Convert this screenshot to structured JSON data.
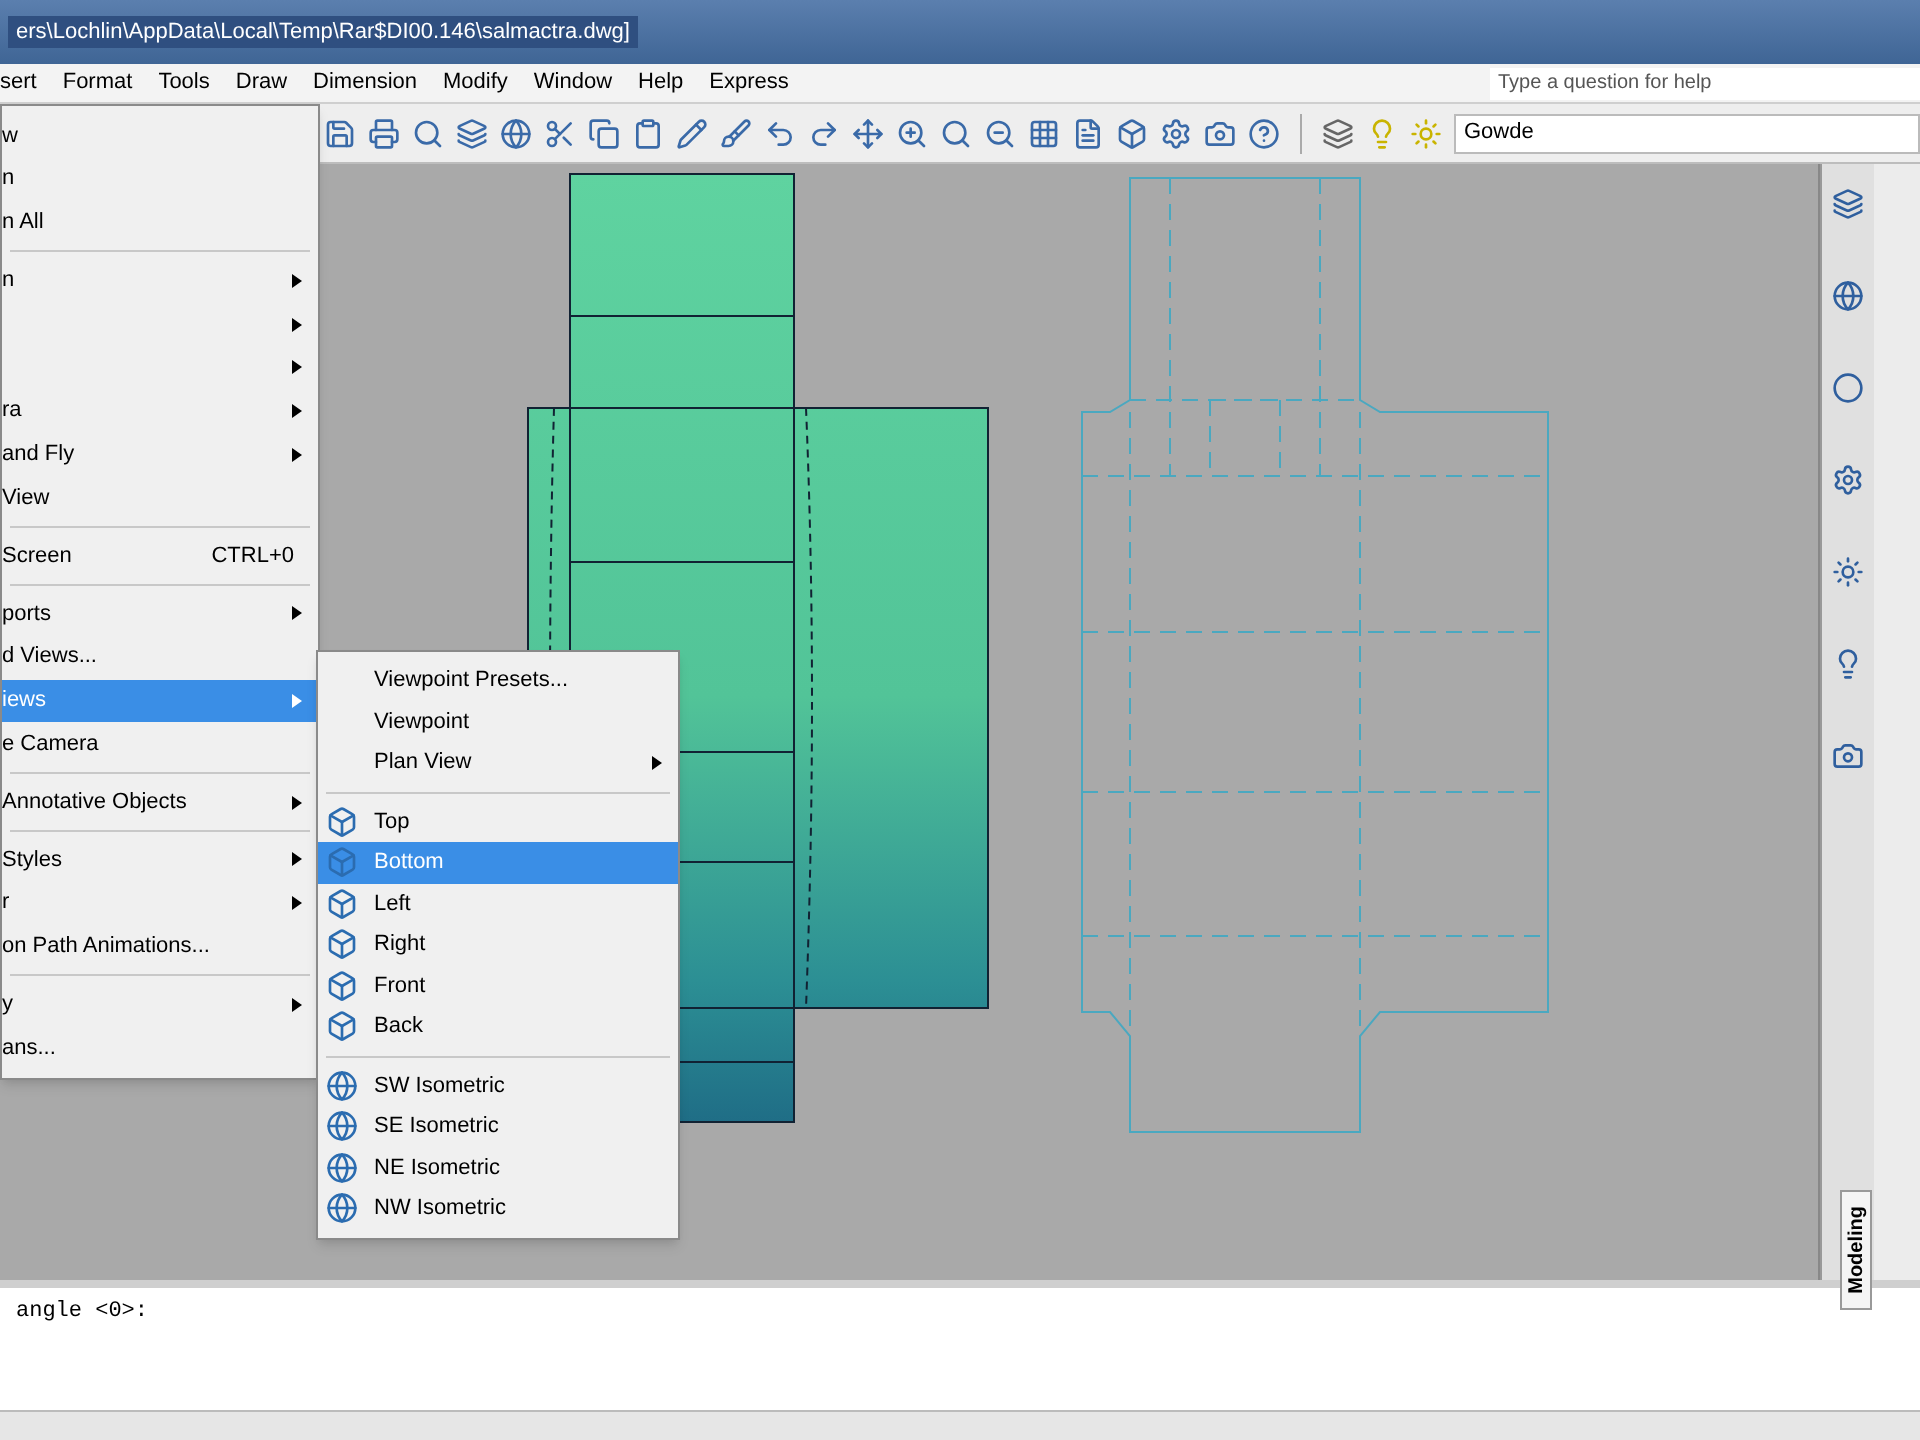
{
  "window": {
    "title": "ers\\Lochlin\\AppData\\Local\\Temp\\Rar$DI00.146\\salmactra.dwg]"
  },
  "menu_bar": {
    "items": [
      {
        "label": "sert"
      },
      {
        "label": "Format"
      },
      {
        "label": "Tools"
      },
      {
        "label": "Draw"
      },
      {
        "label": "Dimension"
      },
      {
        "label": "Modify"
      },
      {
        "label": "Window"
      },
      {
        "label": "Help"
      },
      {
        "label": "Express"
      }
    ]
  },
  "help_search": {
    "placeholder": "Type a question for help"
  },
  "layer_control": {
    "value": "Gowde"
  },
  "view_menu": {
    "items": [
      {
        "kind": "item",
        "label": "w",
        "submenu": false,
        "selected": false
      },
      {
        "kind": "item",
        "label": "n",
        "submenu": false,
        "selected": false
      },
      {
        "kind": "item",
        "label": "n All",
        "submenu": false,
        "selected": false
      },
      {
        "kind": "separator"
      },
      {
        "kind": "item",
        "label": "n",
        "submenu": true,
        "selected": false
      },
      {
        "kind": "item",
        "submenu": true,
        "selected": false
      },
      {
        "kind": "item",
        "submenu": true,
        "selected": false
      },
      {
        "kind": "item",
        "label": "ra",
        "submenu": true,
        "selected": false
      },
      {
        "kind": "item",
        "label": "and Fly",
        "submenu": true,
        "selected": false
      },
      {
        "kind": "item",
        "label": "View",
        "submenu": false,
        "selected": false
      },
      {
        "kind": "separator"
      },
      {
        "kind": "item",
        "label": "Screen",
        "shortcut": "CTRL+0",
        "submenu": false,
        "selected": false
      },
      {
        "kind": "separator"
      },
      {
        "kind": "item",
        "label": "ports",
        "submenu": true,
        "selected": false
      },
      {
        "kind": "item",
        "label": "d Views...",
        "submenu": false,
        "selected": false
      },
      {
        "kind": "item",
        "label": "iews",
        "submenu": true,
        "selected": true
      },
      {
        "kind": "item",
        "label": "e Camera",
        "submenu": false,
        "selected": false
      },
      {
        "kind": "separator"
      },
      {
        "kind": "item",
        "label": "Annotative Objects",
        "submenu": true,
        "selected": false
      },
      {
        "kind": "separator"
      },
      {
        "kind": "item",
        "label": "Styles",
        "submenu": true,
        "selected": false
      },
      {
        "kind": "item",
        "label": "r",
        "submenu": true,
        "selected": false
      },
      {
        "kind": "item",
        "label": "on Path Animations...",
        "submenu": false,
        "selected": false
      },
      {
        "kind": "separator"
      },
      {
        "kind": "item",
        "label": "y",
        "submenu": true,
        "selected": false
      },
      {
        "kind": "item",
        "label": "ans...",
        "submenu": false,
        "selected": false
      }
    ]
  },
  "views_submenu": {
    "items": [
      {
        "kind": "text",
        "label": "Viewpoint Presets...",
        "submenu": false,
        "selected": false
      },
      {
        "kind": "text",
        "label": "Viewpoint",
        "submenu": false,
        "selected": false
      },
      {
        "kind": "text",
        "label": "Plan View",
        "submenu": true,
        "selected": false
      },
      {
        "kind": "separator"
      },
      {
        "kind": "ortho",
        "label": "Top",
        "submenu": false,
        "selected": false
      },
      {
        "kind": "ortho",
        "label": "Bottom",
        "submenu": false,
        "selected": true
      },
      {
        "kind": "ortho",
        "label": "Left",
        "submenu": false,
        "selected": false
      },
      {
        "kind": "ortho",
        "label": "Right",
        "submenu": false,
        "selected": false
      },
      {
        "kind": "ortho",
        "label": "Front",
        "submenu": false,
        "selected": false
      },
      {
        "kind": "ortho",
        "label": "Back",
        "submenu": false,
        "selected": false
      },
      {
        "kind": "separator"
      },
      {
        "kind": "iso",
        "label": "SW Isometric",
        "submenu": false,
        "selected": false
      },
      {
        "kind": "iso",
        "label": "SE Isometric",
        "submenu": false,
        "selected": false
      },
      {
        "kind": "iso",
        "label": "NE Isometric",
        "submenu": false,
        "selected": false
      },
      {
        "kind": "iso",
        "label": "NW Isometric",
        "submenu": false,
        "selected": false
      }
    ]
  },
  "command_line": {
    "prompt": "angle <0>:"
  },
  "palette": {
    "tab_label": "Modeling"
  }
}
